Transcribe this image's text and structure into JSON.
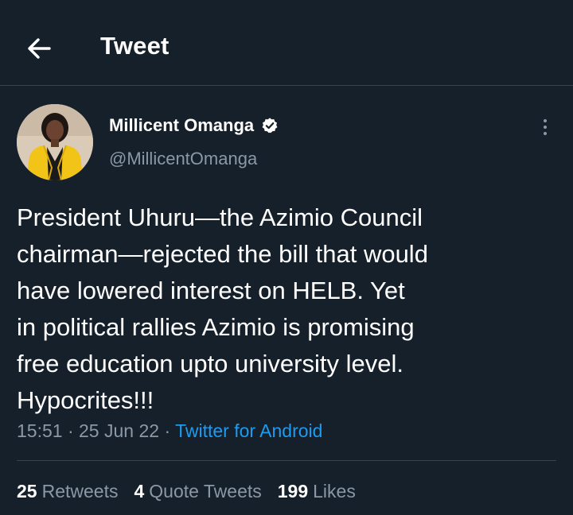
{
  "header": {
    "title": "Tweet",
    "back_icon": "arrow-left-icon"
  },
  "author": {
    "name": "Millicent Omanga",
    "handle": "@MillicentOmanga",
    "verified_icon": "verified-badge-icon"
  },
  "tweet": {
    "lines": [
      "President Uhuru—the Azimio Council",
      "chairman—rejected the bill that would",
      "have lowered interest on HELB. Yet",
      "in political rallies Azimio is promising",
      "free education upto university level.",
      "Hypocrites!!!"
    ],
    "time": "15:51",
    "date": "25 Jun 22",
    "source": "Twitter for Android"
  },
  "stats": {
    "retweets_count": "25",
    "retweets_label": "Retweets",
    "quotes_count": "4",
    "quotes_label": "Quote Tweets",
    "likes_count": "199",
    "likes_label": "Likes"
  },
  "colors": {
    "background": "#15202b",
    "divider": "#38444d",
    "secondary_text": "#8b98a5",
    "link": "#1d9bf0",
    "verified": "#ffffff"
  }
}
